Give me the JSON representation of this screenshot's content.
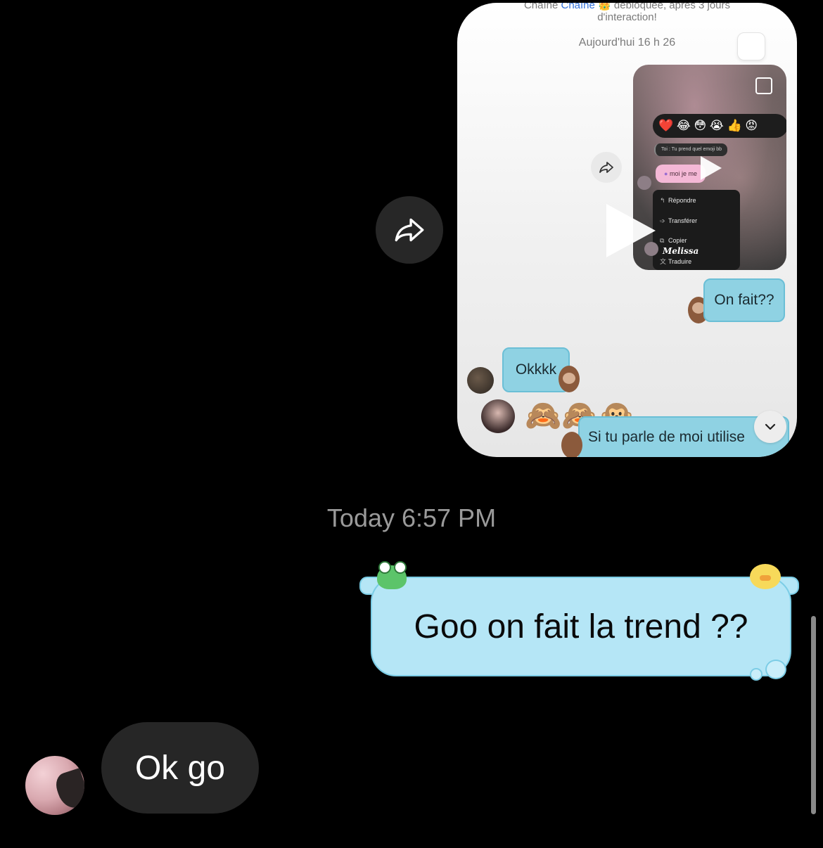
{
  "shared_video": {
    "system_text_line1_a": "Chaîne",
    "system_text_line1_link": "Chaîne",
    "system_text_line1_b": "débloquée, après 3 jours",
    "system_text_line2": "d'interaction!",
    "timestamp": "Aujourd'hui 16 h 26",
    "emoji_bar": "❤️ 😂 😳 😭 👍 😡",
    "quote_text": "Toi : Tu prend quel emoji bb",
    "pink_bubble_text": "moi je me",
    "context_menu": [
      "Répondre",
      "Transférer",
      "Copier",
      "Traduire"
    ],
    "sender_name": "Melissa",
    "message_on_fait": "On fait??",
    "message_okkkk": "Okkkk",
    "monkeys": "🙈🙈🙊",
    "message_si_tu": "Si tu parle de moi utilise"
  },
  "outer_timestamp": "Today 6:57 PM",
  "my_message": "Goo on fait la trend ??",
  "their_message": "Ok go",
  "icons": {
    "forward": "share-arrow-icon",
    "chevron": "chevron-down-icon"
  }
}
